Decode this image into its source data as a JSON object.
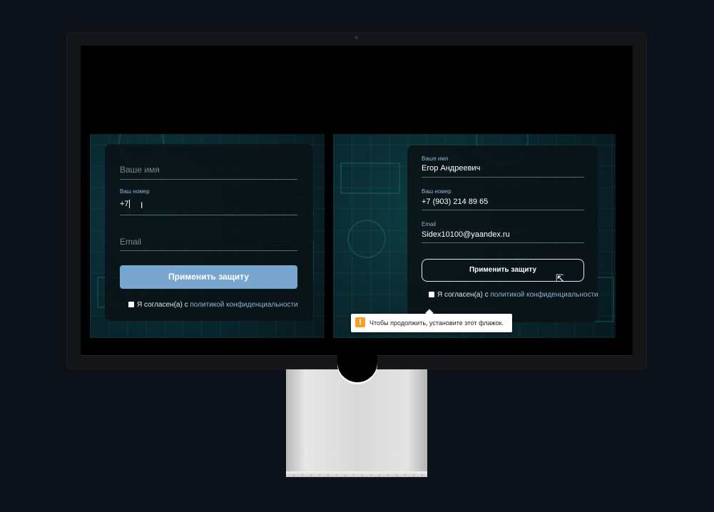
{
  "left_form": {
    "name_placeholder": "Ваше имя",
    "phone_label": "Ваш номер",
    "phone_value": "+7",
    "email_placeholder": "Email",
    "submit_label": "Применить защиту",
    "agree_text": "Я согласен(а) с",
    "agree_link": "политикой конфиденциальности"
  },
  "right_form": {
    "name_label": "Ваше имя",
    "name_value": "Егор Андреевич",
    "phone_label": "Ваш номер",
    "phone_value": "+7 (903) 214 89 65",
    "email_label": "Email",
    "email_value": "Sidex10100@yaandex.ru",
    "submit_label": "Применить защиту",
    "agree_text": "Я согласен(а) с",
    "agree_link": "политикой конфиденциальности",
    "validation_tooltip": "Чтобы продолжить, установите этот флажок.",
    "warning_icon": "!"
  },
  "colors": {
    "accent": "#79a6cf",
    "link": "#8fb3d6",
    "warning": "#f2a22a",
    "page_bg": "#0d1119"
  },
  "icons": {
    "cursor": "text-cursor-icon",
    "click": "click-cursor-icon"
  }
}
